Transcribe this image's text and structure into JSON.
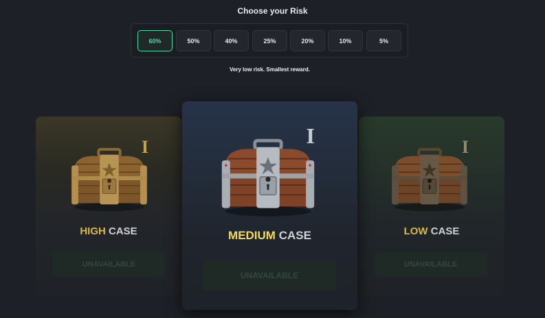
{
  "risk": {
    "title": "Choose your Risk",
    "options": [
      "60%",
      "50%",
      "40%",
      "25%",
      "20%",
      "10%",
      "5%"
    ],
    "selected": "60%",
    "description": "Very low risk. Smallest reward."
  },
  "cases": {
    "high": {
      "tier": "I",
      "name_first": "HIGH",
      "name_second": "CASE",
      "button": "UNAVAILABLE"
    },
    "medium": {
      "tier": "I",
      "name_first": "MEDIUM",
      "name_second": "CASE",
      "button": "UNAVAILABLE"
    },
    "low": {
      "tier": "I",
      "name_first": "LOW",
      "name_second": "CASE",
      "button": "UNAVAILABLE"
    }
  },
  "colors": {
    "accent_green": "#4ed8a6",
    "gold": "#d8b84a",
    "medium_name": "#f3da5a",
    "background": "#1d2026"
  },
  "icons": [
    "wooden-chest-gold-icon",
    "wooden-chest-silver-icon",
    "wooden-chest-dark-icon"
  ]
}
